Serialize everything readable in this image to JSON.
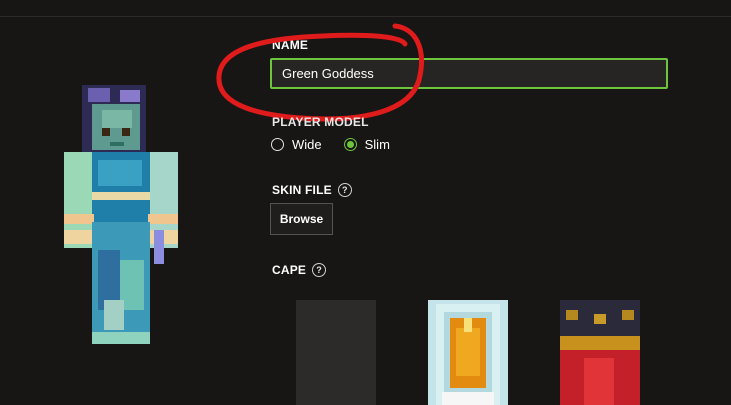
{
  "form": {
    "name_label": "NAME",
    "name_value": "Green Goddess",
    "player_model_label": "PLAYER MODEL",
    "model_options": [
      "Wide",
      "Slim"
    ],
    "model_selected": "Slim",
    "skin_file_label": "SKIN FILE",
    "browse_label": "Browse",
    "cape_label": "CAPE",
    "help_glyph": "?"
  },
  "capes": [
    {
      "name": "none",
      "selected": false
    },
    {
      "name": "yellow-cape",
      "selected": false
    },
    {
      "name": "red-cape",
      "selected": false
    }
  ],
  "colors": {
    "background": "#171615",
    "accent_green": "#6dc53b",
    "annotation_red": "#e01b1b"
  },
  "icons": {
    "help": "question-circle-icon",
    "radio_checked": "radio-checked-icon",
    "radio_unchecked": "radio-unchecked-icon"
  }
}
